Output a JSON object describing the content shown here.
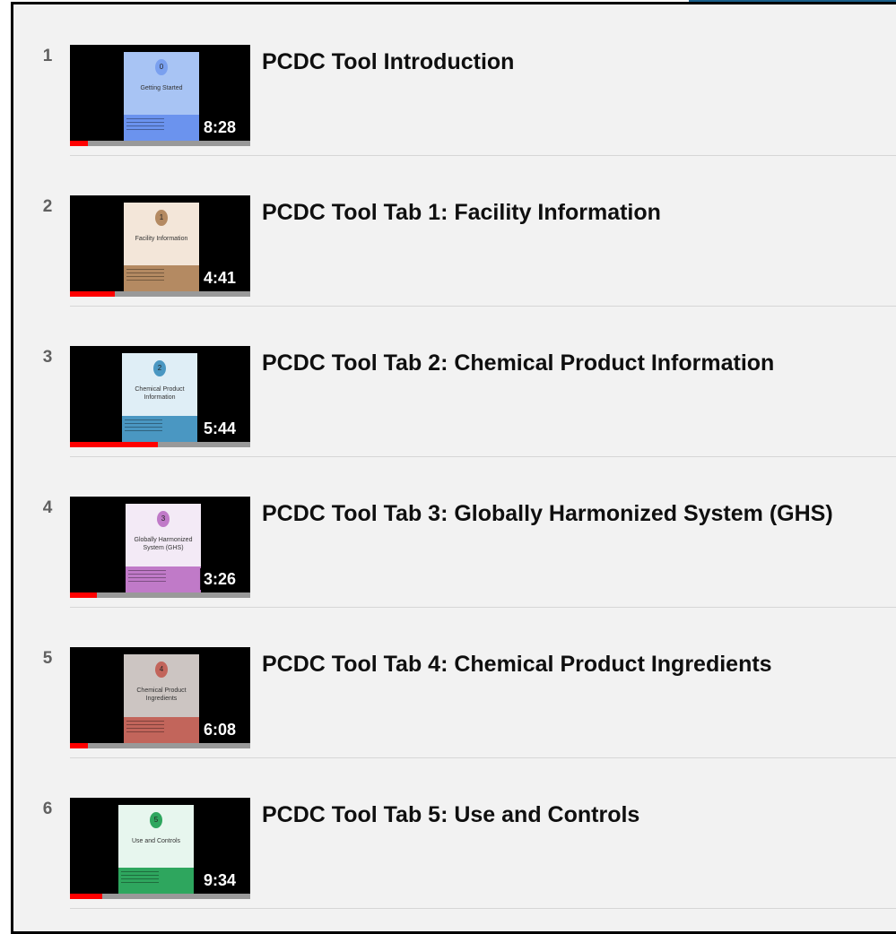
{
  "playlist": [
    {
      "index": "1",
      "title": "PCDC Tool Introduction",
      "duration": "8:28",
      "progress": 0.1,
      "slide": {
        "number": "0",
        "caption": "Getting Started",
        "top_color": "#a8c4f4",
        "bottom_color": "#6b93ee",
        "circle_color": "#7aa0ef"
      }
    },
    {
      "index": "2",
      "title": "PCDC Tool Tab 1: Facility Information",
      "duration": "4:41",
      "progress": 0.25,
      "slide": {
        "number": "1",
        "caption": "Facility Information",
        "top_color": "#f3e6d9",
        "bottom_color": "#b48a62",
        "circle_color": "#b48a62"
      }
    },
    {
      "index": "3",
      "title": "PCDC Tool Tab 2: Chemical Product Information",
      "duration": "5:44",
      "progress": 0.49,
      "slide": {
        "number": "2",
        "caption": "Chemical Product Information",
        "top_color": "#dfeef6",
        "bottom_color": "#4a97c2",
        "circle_color": "#4a97c2"
      }
    },
    {
      "index": "4",
      "title": "PCDC Tool Tab 3: Globally Harmonized System (GHS)",
      "duration": "3:26",
      "progress": 0.15,
      "slide": {
        "number": "3",
        "caption": "Globally Harmonized System (GHS)",
        "top_color": "#f3eaf6",
        "bottom_color": "#c07ac8",
        "circle_color": "#c07ac8"
      }
    },
    {
      "index": "5",
      "title": "PCDC Tool Tab 4: Chemical Product Ingredients",
      "duration": "6:08",
      "progress": 0.1,
      "slide": {
        "number": "4",
        "caption": "Chemical Product Ingredients",
        "top_color": "#ccc5c2",
        "bottom_color": "#c2655b",
        "circle_color": "#c2655b"
      }
    },
    {
      "index": "6",
      "title": "PCDC Tool Tab 5: Use and Controls",
      "duration": "9:34",
      "progress": 0.18,
      "slide": {
        "number": "5",
        "caption": "Use and Controls",
        "top_color": "#e7f6ee",
        "bottom_color": "#2ea65e",
        "circle_color": "#2ea65e"
      }
    }
  ]
}
